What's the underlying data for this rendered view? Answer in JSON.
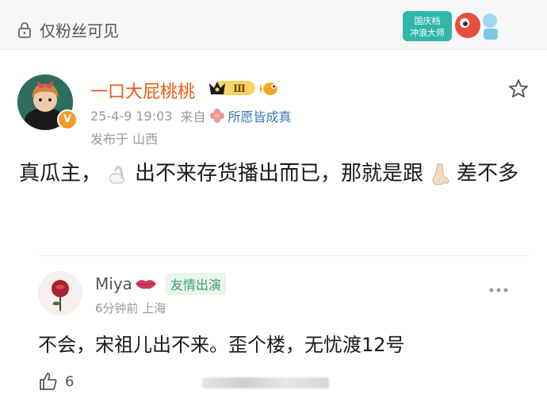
{
  "topbar": {
    "visibility_label": "仅粉丝可见",
    "promo_badge_text_1": "国庆档",
    "promo_badge_text_2": "冲浪大师"
  },
  "post": {
    "username": "一口大屁桃桃",
    "level": "Ⅲ",
    "verified_mark": "V",
    "time": "25-4-9 19:03",
    "source_prefix": "来自",
    "source": "所愿皆成真",
    "location": "发布于 山西",
    "text_part1": "真瓜主，",
    "text_part2": "出不来存货播出而已，那就是跟",
    "text_part3": "差不多",
    "inline_icons": [
      "swan-icon",
      "nose-icon"
    ]
  },
  "reply": {
    "username": "Miya",
    "tag": "友情出演",
    "meta": "6分钟前 上海",
    "text": "不会，宋祖儿出不来。歪个楼，无忧渡12号",
    "likes": "6"
  },
  "colors": {
    "username": "#e8590c",
    "source_link": "#3a74b8",
    "friend_tag": "#3d9b68"
  }
}
